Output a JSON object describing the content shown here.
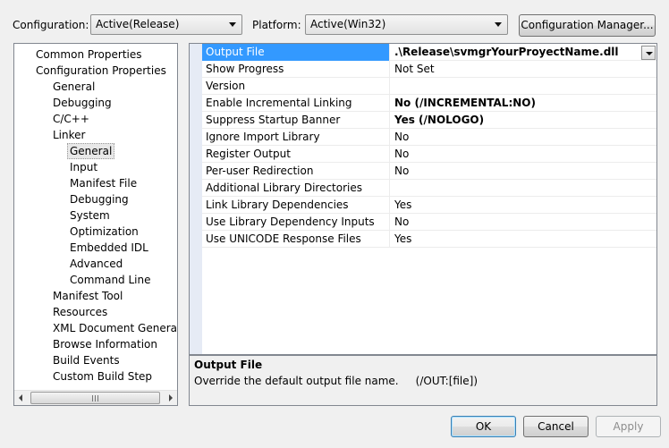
{
  "header": {
    "configuration_label": "Configuration:",
    "configuration_value": "Active(Release)",
    "platform_label": "Platform:",
    "platform_value": "Active(Win32)",
    "config_manager_button": "Configuration Manager..."
  },
  "tree": {
    "items": [
      {
        "label": "Common Properties",
        "level": 0
      },
      {
        "label": "Configuration Properties",
        "level": 0
      },
      {
        "label": "General",
        "level": 1
      },
      {
        "label": "Debugging",
        "level": 1
      },
      {
        "label": "C/C++",
        "level": 1
      },
      {
        "label": "Linker",
        "level": 1
      },
      {
        "label": "General",
        "level": 2,
        "selected": true
      },
      {
        "label": "Input",
        "level": 2
      },
      {
        "label": "Manifest File",
        "level": 2
      },
      {
        "label": "Debugging",
        "level": 2
      },
      {
        "label": "System",
        "level": 2
      },
      {
        "label": "Optimization",
        "level": 2
      },
      {
        "label": "Embedded IDL",
        "level": 2
      },
      {
        "label": "Advanced",
        "level": 2
      },
      {
        "label": "Command Line",
        "level": 2
      },
      {
        "label": "Manifest Tool",
        "level": 1
      },
      {
        "label": "Resources",
        "level": 1
      },
      {
        "label": "XML Document Generator",
        "level": 1
      },
      {
        "label": "Browse Information",
        "level": 1
      },
      {
        "label": "Build Events",
        "level": 1
      },
      {
        "label": "Custom Build Step",
        "level": 1
      }
    ]
  },
  "properties": [
    {
      "name": "Output File",
      "value": ".\\Release\\svmgrYourProyectName.dll",
      "bold": true,
      "selected": true
    },
    {
      "name": "Show Progress",
      "value": "Not Set",
      "bold": false
    },
    {
      "name": "Version",
      "value": "",
      "bold": false
    },
    {
      "name": "Enable Incremental Linking",
      "value": "No (/INCREMENTAL:NO)",
      "bold": true
    },
    {
      "name": "Suppress Startup Banner",
      "value": "Yes (/NOLOGO)",
      "bold": true
    },
    {
      "name": "Ignore Import Library",
      "value": "No",
      "bold": false
    },
    {
      "name": "Register Output",
      "value": "No",
      "bold": false
    },
    {
      "name": "Per-user Redirection",
      "value": "No",
      "bold": false
    },
    {
      "name": "Additional Library Directories",
      "value": "",
      "bold": false
    },
    {
      "name": "Link Library Dependencies",
      "value": "Yes",
      "bold": false
    },
    {
      "name": "Use Library Dependency Inputs",
      "value": "No",
      "bold": false
    },
    {
      "name": "Use UNICODE Response Files",
      "value": "Yes",
      "bold": false
    }
  ],
  "description": {
    "title": "Output File",
    "text": "Override the default output file name.     (/OUT:[file])"
  },
  "buttons": {
    "ok": "OK",
    "cancel": "Cancel",
    "apply": "Apply"
  },
  "colors": {
    "selection": "#3399ff",
    "gutter": "#e6ebf5"
  }
}
